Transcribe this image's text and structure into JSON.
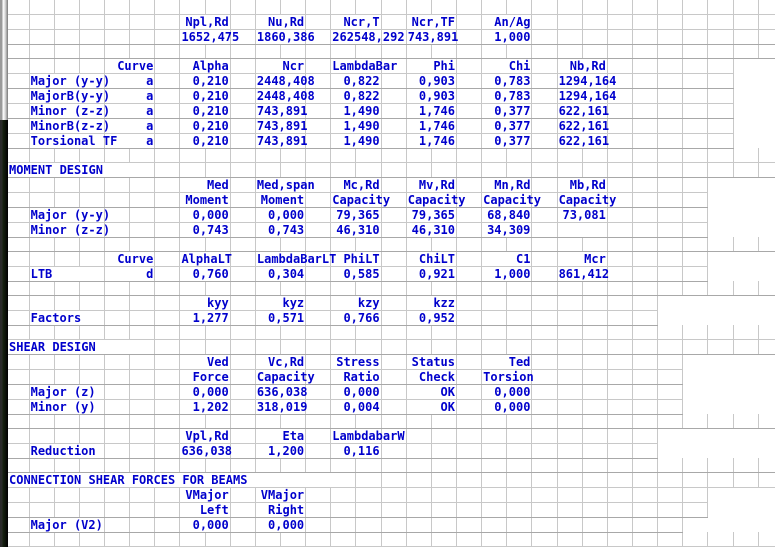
{
  "document": {
    "kind": "spreadsheet-design-report",
    "text_color": "#0000cc",
    "grid_color": "#c8c8c8",
    "background": "#ffffff"
  },
  "sections": {
    "buckling": {
      "axial_header": {
        "npl_rd": "Npl,Rd",
        "nu_rd": "Nu,Rd",
        "ncr_t": "Ncr,T",
        "ncr_tf": "Ncr,TF",
        "an_ag": "An/Ag"
      },
      "axial_values": {
        "npl_rd": "1652,475",
        "nu_rd": "1860,386",
        "ncr_t": "262548,292",
        "ncr_tf": "743,891",
        "an_ag": "1,000"
      },
      "table_header": {
        "curve": "Curve",
        "alpha": "Alpha",
        "ncr": "Ncr",
        "lambdabar": "LambdaBar",
        "phi": "Phi",
        "chi": "Chi",
        "nb_rd": "Nb,Rd"
      },
      "rows": [
        {
          "axis": "Major  (y-y)",
          "curve": "a",
          "alpha": "0,210",
          "ncr": "2448,408",
          "lambdabar": "0,822",
          "phi": "0,903",
          "chi": "0,783",
          "nb_rd": "1294,164"
        },
        {
          "axis": "MajorB(y-y)",
          "curve": "a",
          "alpha": "0,210",
          "ncr": "2448,408",
          "lambdabar": "0,822",
          "phi": "0,903",
          "chi": "0,783",
          "nb_rd": "1294,164"
        },
        {
          "axis": "Minor  (z-z)",
          "curve": "a",
          "alpha": "0,210",
          "ncr": "743,891",
          "lambdabar": "1,490",
          "phi": "1,746",
          "chi": "0,377",
          "nb_rd": "622,161"
        },
        {
          "axis": "MinorB(z-z)",
          "curve": "a",
          "alpha": "0,210",
          "ncr": "743,891",
          "lambdabar": "1,490",
          "phi": "1,746",
          "chi": "0,377",
          "nb_rd": "622,161"
        },
        {
          "axis": "Torsional TF",
          "curve": "a",
          "alpha": "0,210",
          "ncr": "743,891",
          "lambdabar": "1,490",
          "phi": "1,746",
          "chi": "0,377",
          "nb_rd": "622,161"
        }
      ]
    },
    "moment_design": {
      "title": "MOMENT DESIGN",
      "header_line1": {
        "med": "Med",
        "med_span": "Med,span",
        "mc_rd": "Mc,Rd",
        "mv_rd": "Mv,Rd",
        "mn_rd": "Mn,Rd",
        "mb_rd": "Mb,Rd"
      },
      "header_line2": {
        "med": "Moment",
        "med_span": "Moment",
        "mc_rd": "Capacity",
        "mv_rd": "Capacity",
        "mn_rd": "Capacity",
        "mb_rd": "Capacity"
      },
      "rows": [
        {
          "axis": "Major  (y-y)",
          "med": "0,000",
          "med_span": "0,000",
          "mc_rd": "79,365",
          "mv_rd": "79,365",
          "mn_rd": "68,840",
          "mb_rd": "73,081"
        },
        {
          "axis": "Minor  (z-z)",
          "med": "0,743",
          "med_span": "0,743",
          "mc_rd": "46,310",
          "mv_rd": "46,310",
          "mn_rd": "34,309",
          "mb_rd": ""
        }
      ],
      "ltb_header": {
        "curve": "Curve",
        "alpha_lt": "AlphaLT",
        "lambdabar_lt": "LambdaBarLT",
        "phi_lt": "PhiLT",
        "chi_lt": "ChiLT",
        "c1": "C1",
        "mcr": "Mcr"
      },
      "ltb_row": {
        "label": "LTB",
        "curve": "d",
        "alpha_lt": "0,760",
        "lambdabar_lt": "0,304",
        "phi_lt": "0,585",
        "chi_lt": "0,921",
        "c1": "1,000",
        "mcr": "861,412"
      },
      "factors_header": {
        "kyy": "kyy",
        "kyz": "kyz",
        "kzy": "kzy",
        "kzz": "kzz"
      },
      "factors_row": {
        "label": "Factors",
        "kyy": "1,277",
        "kyz": "0,571",
        "kzy": "0,766",
        "kzz": "0,952"
      }
    },
    "shear_design": {
      "title": "SHEAR DESIGN",
      "header_line1": {
        "ved": "Ved",
        "vc_rd": "Vc,Rd",
        "stress": "Stress",
        "status": "Status",
        "ted": "Ted"
      },
      "header_line2": {
        "ved": "Force",
        "vc_rd": "Capacity",
        "stress": "Ratio",
        "status": "Check",
        "ted": "Torsion"
      },
      "rows": [
        {
          "axis": "Major  (z)",
          "ved": "0,000",
          "vc_rd": "636,038",
          "ratio": "0,000",
          "status": "OK",
          "ted": "0,000"
        },
        {
          "axis": "Minor  (y)",
          "ved": "1,202",
          "vc_rd": "318,019",
          "ratio": "0,004",
          "status": "OK",
          "ted": "0,000"
        }
      ],
      "reduction_header": {
        "vpl_rd": "Vpl,Rd",
        "eta": "Eta",
        "lambdabar_w": "LambdabarW"
      },
      "reduction_row": {
        "label": "Reduction",
        "vpl_rd": "636,038",
        "eta": "1,200",
        "lambdabar_w": "0,116"
      }
    },
    "connection_shear": {
      "title": "CONNECTION SHEAR FORCES FOR BEAMS",
      "header_line1": {
        "left": "VMajor",
        "right": "VMajor"
      },
      "header_line2": {
        "left": "Left",
        "right": "Right"
      },
      "rows": [
        {
          "axis": "Major  (V2)",
          "left": "0,000",
          "right": "0,000"
        }
      ]
    }
  }
}
